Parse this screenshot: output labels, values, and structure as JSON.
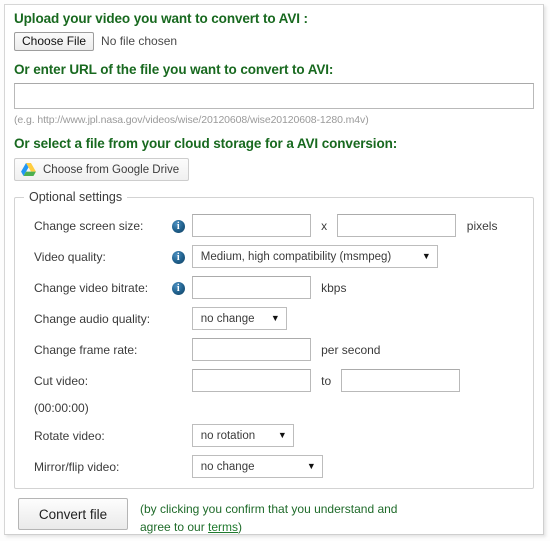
{
  "upload": {
    "heading": "Upload your video you want to convert to AVI :",
    "choose_file_label": "Choose File",
    "no_file_text": "No file chosen"
  },
  "url_section": {
    "heading": "Or enter URL of the file you want to convert to AVI:",
    "value": "",
    "placeholder": "",
    "hint": "(e.g. http://www.jpl.nasa.gov/videos/wise/20120608/wise20120608-1280.m4v)"
  },
  "cloud": {
    "heading": "Or select a file from your cloud storage for a AVI conversion:",
    "google_drive_label": "Choose from Google Drive"
  },
  "optional": {
    "legend": "Optional settings",
    "rows": {
      "screen_size": {
        "label": "Change screen size:",
        "info": "i",
        "width_value": "",
        "separator": "x",
        "height_value": "",
        "unit": "pixels"
      },
      "video_quality": {
        "label": "Video quality:",
        "info": "i",
        "selected": "Medium, high compatibility (msmpeg)",
        "caret": "▼"
      },
      "video_bitrate": {
        "label": "Change video bitrate:",
        "info": "i",
        "value": "",
        "unit": "kbps"
      },
      "audio_quality": {
        "label": "Change audio quality:",
        "selected": "no change",
        "caret": "▼"
      },
      "frame_rate": {
        "label": "Change frame rate:",
        "value": "",
        "unit": "per second"
      },
      "cut_video": {
        "label": "Cut video:",
        "label2": "(00:00:00)",
        "from_value": "",
        "separator": "to",
        "to_value": ""
      },
      "rotate_video": {
        "label": "Rotate video:",
        "selected": "no rotation",
        "caret": "▼"
      },
      "mirror_flip": {
        "label": "Mirror/flip video:",
        "selected": "no change",
        "caret": "▼"
      }
    }
  },
  "footer": {
    "convert_label": "Convert file",
    "note_line1": "(by clicking you confirm that you understand and",
    "note_line2_before": "agree to our ",
    "note_link": "terms",
    "note_line2_after": ")"
  },
  "colors": {
    "heading_green": "#18691f",
    "link_green": "#1f7a2e",
    "info_blue": "#1f5f8b",
    "hint_gray": "#9a9a9a"
  }
}
